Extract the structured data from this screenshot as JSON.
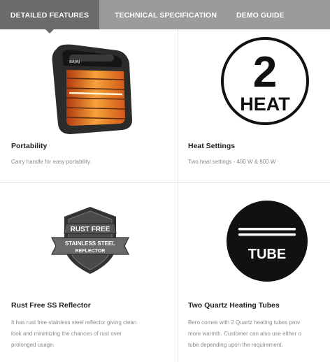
{
  "tabs": [
    {
      "label": "DETAILED FEATURES",
      "active": true
    },
    {
      "label": "TECHNICAL SPECIFICATION",
      "active": false
    },
    {
      "label": "DEMO GUIDE",
      "active": false
    }
  ],
  "features": [
    {
      "title": "Portability",
      "description": "Carry handle for easy portability.",
      "icon": "heater-icon",
      "image_text": "BAJAJ"
    },
    {
      "title": "Heat Settings",
      "description": "Two heat settings - 400 W & 800 W",
      "icon": "two-heat-icon",
      "image_text": {
        "number": "2",
        "word": "HEAT"
      }
    },
    {
      "title": "Rust Free SS Reflector",
      "description_lines": [
        "It has rust free stainless steel reflector giving clean",
        "look and minimizing the chances of rust over",
        "prolonged usage."
      ],
      "icon": "rust-free-badge-icon",
      "image_text": {
        "top": "RUST FREE",
        "bottom1": "STAINLESS STEEL",
        "bottom2": "REFLECTOR"
      }
    },
    {
      "title": "Two Quartz Heating Tubes",
      "description_lines": [
        "Bero comes with 2 Quartz heating tubes prov",
        "more warmth. Customer can also use either o",
        "tube depending upon the requirement."
      ],
      "icon": "tube-icon",
      "image_text": "TUBE"
    }
  ],
  "colors": {
    "tab_bar": "#9b9b9b",
    "active_tab": "#6b6b6b",
    "divider": "#e4e4e4"
  }
}
